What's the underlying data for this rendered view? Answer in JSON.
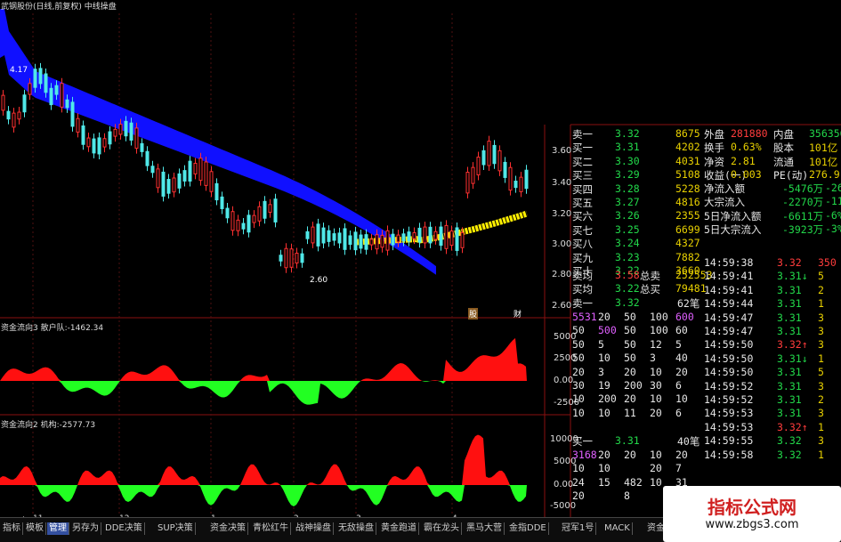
{
  "main_title": "武钢股份(日线,前复权) 中线操盘",
  "price": {
    "high_label": "4.17",
    "low_label": "2.60",
    "axis": [
      "3.60",
      "3.40",
      "3.20",
      "3.00",
      "2.80",
      "2.60"
    ],
    "markers": [
      "股",
      "财"
    ]
  },
  "ind1": {
    "title": "资金流向3",
    "label": "散户队:-1462.34",
    "axis": [
      "5000",
      "2500",
      "0.00",
      "-2500"
    ]
  },
  "ind2": {
    "title": "资金流向2",
    "label": "机构:-2577.73",
    "axis": [
      "10000",
      "5000",
      "0.00",
      "-5000"
    ]
  },
  "dates": [
    "2015年",
    "11",
    "12",
    "1",
    "2",
    "3",
    "4"
  ],
  "period": "日线",
  "quote": {
    "sells": [
      {
        "l": "卖一",
        "p": "3.32",
        "v": "8675"
      },
      {
        "l": "买一",
        "p": "3.31",
        "v": "4202"
      },
      {
        "l": "买二",
        "p": "3.30",
        "v": "4031"
      },
      {
        "l": "买三",
        "p": "3.29",
        "v": "5108"
      },
      {
        "l": "买四",
        "p": "3.28",
        "v": "5228"
      },
      {
        "l": "买五",
        "p": "3.27",
        "v": "4816"
      },
      {
        "l": "买六",
        "p": "3.26",
        "v": "2355"
      },
      {
        "l": "买七",
        "p": "3.25",
        "v": "6699"
      },
      {
        "l": "买八",
        "p": "3.24",
        "v": "4327"
      },
      {
        "l": "买九",
        "p": "3.23",
        "v": "7882"
      },
      {
        "l": "买十",
        "p": "3.22",
        "v": "3660"
      }
    ],
    "avg": [
      {
        "l": "卖均",
        "p": "3.58",
        "k": "总卖",
        "v": "252553"
      },
      {
        "l": "买均",
        "p": "3.22",
        "k": "总买",
        "v": "79481"
      }
    ],
    "stats": [
      {
        "a": "外盘",
        "b": "281880",
        "c": "内盘",
        "d": "356356"
      },
      {
        "a": "换手",
        "b": "0.63%",
        "c": "股本",
        "d": "101亿"
      },
      {
        "a": "净资",
        "b": "2.81",
        "c": "流通",
        "d": "101亿"
      },
      {
        "a": "收益(一)",
        "b": "0.003",
        "c": "PE(动)",
        "d": "276.9"
      }
    ],
    "flows": [
      {
        "l": "净流入额",
        "v": "-5476万",
        "pct": "-26%"
      },
      {
        "l": "大宗流入",
        "v": "-2270万",
        "pct": "-11%"
      },
      {
        "l": "5日净流入额",
        "v": "-6611万",
        "pct": "-6%"
      },
      {
        "l": "5日大宗流入",
        "v": "-3923万",
        "pct": "-3%"
      }
    ],
    "ticks": [
      [
        "14:59:38",
        "3.32",
        "350"
      ],
      [
        "14:59:41",
        "3.31↓",
        "5"
      ],
      [
        "14:59:41",
        "3.31",
        "2"
      ],
      [
        "14:59:44",
        "3.31",
        "1"
      ],
      [
        "14:59:47",
        "3.31",
        "3"
      ],
      [
        "14:59:47",
        "3.31",
        "3"
      ],
      [
        "14:59:50",
        "3.32↑",
        "3"
      ],
      [
        "14:59:50",
        "3.31↓",
        "1"
      ],
      [
        "14:59:50",
        "3.31",
        "5"
      ],
      [
        "14:59:52",
        "3.31",
        "3"
      ],
      [
        "14:59:52",
        "3.31",
        "2"
      ],
      [
        "14:59:53",
        "3.31",
        "3"
      ],
      [
        "14:59:53",
        "3.32↑",
        "1"
      ],
      [
        "14:59:55",
        "3.32",
        "3"
      ],
      [
        "14:59:58",
        "3.32",
        "1"
      ]
    ],
    "level1": {
      "label": "卖一",
      "price": "3.32",
      "count": "62笔"
    },
    "grid1": [
      [
        "5531",
        "20",
        "50",
        "100",
        "600"
      ],
      [
        "50",
        "500",
        "50",
        "100",
        "60"
      ],
      [
        "50",
        "5",
        "50",
        "12",
        "5"
      ],
      [
        "50",
        "10",
        "50",
        "3",
        "40"
      ],
      [
        "20",
        "3",
        "20",
        "10",
        "20"
      ],
      [
        "30",
        "19",
        "200",
        "30",
        "6"
      ],
      [
        "10",
        "200",
        "20",
        "10",
        "10"
      ],
      [
        "10",
        "10",
        "11",
        "20",
        "6"
      ]
    ],
    "level2": {
      "label": "买一",
      "price": "3.31",
      "count": "40笔"
    },
    "grid2": [
      [
        "3168",
        "20",
        "20",
        "10",
        "20"
      ],
      [
        "10",
        "10",
        "",
        "20",
        "7"
      ],
      [
        "24",
        "15",
        "482",
        "10",
        "31"
      ],
      [
        "20",
        "",
        "8",
        "",
        "10"
      ],
      [
        "",
        "",
        "",
        "",
        ""
      ]
    ]
  },
  "toolbar": [
    "指标",
    "模板",
    "管理",
    "另存为",
    "DDE决策",
    "SUP决策",
    "资金决策",
    "青松红牛",
    "战神操盘",
    "无敌操盘",
    "黄金跑道",
    "霸在龙头",
    "黑马大营",
    "金指DDE",
    "冠军1号",
    "MACK",
    "资金流入"
  ],
  "toolbar_active": 2,
  "watermark": {
    "title": "指标公式网",
    "url": "www.zbgs3.com"
  }
}
